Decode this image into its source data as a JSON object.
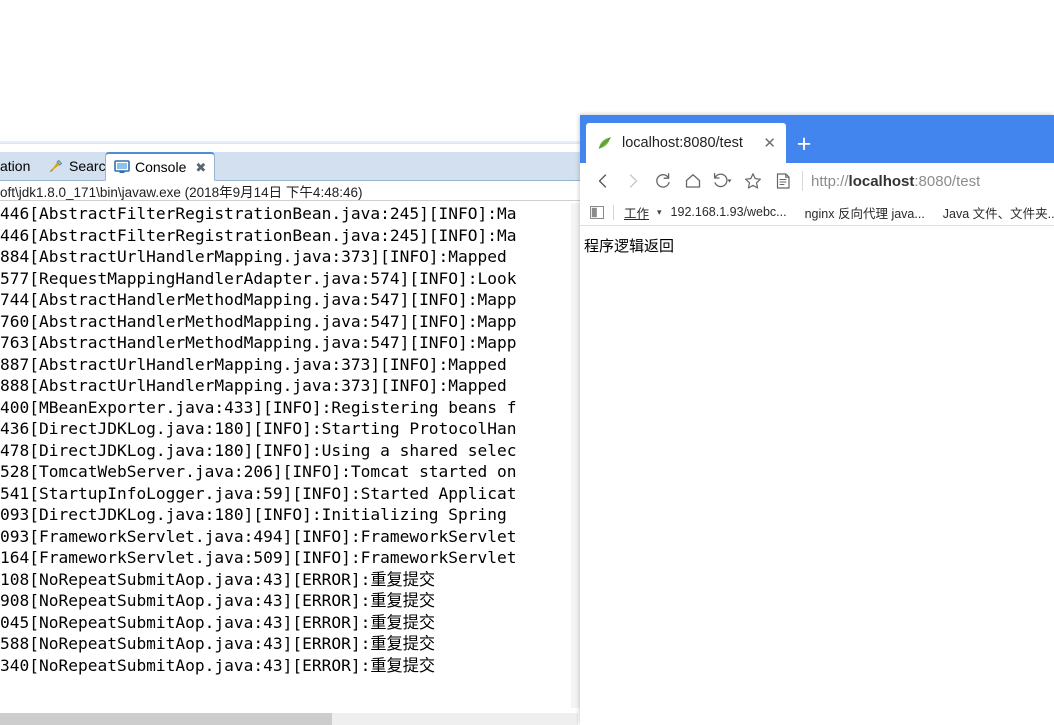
{
  "eclipse": {
    "tabs": [
      {
        "label": "ation",
        "icon": "",
        "active": false,
        "closable": false
      },
      {
        "label": "Search",
        "icon": "search-icon",
        "active": false,
        "closable": false
      },
      {
        "label": "Console",
        "icon": "console-icon",
        "active": true,
        "closable": true,
        "close_glyph": "✖"
      }
    ],
    "console_header": "oft\\jdk1.8.0_171\\bin\\javaw.exe (2018年9月14日 下午4:48:46)",
    "log_lines": [
      "446[AbstractFilterRegistrationBean.java:245][INFO]:Ma",
      "446[AbstractFilterRegistrationBean.java:245][INFO]:Ma",
      "884[AbstractUrlHandlerMapping.java:373][INFO]:Mapped",
      "577[RequestMappingHandlerAdapter.java:574][INFO]:Look",
      "744[AbstractHandlerMethodMapping.java:547][INFO]:Mapp",
      "760[AbstractHandlerMethodMapping.java:547][INFO]:Mapp",
      "763[AbstractHandlerMethodMapping.java:547][INFO]:Mapp",
      "887[AbstractUrlHandlerMapping.java:373][INFO]:Mapped",
      "888[AbstractUrlHandlerMapping.java:373][INFO]:Mapped",
      "400[MBeanExporter.java:433][INFO]:Registering beans f",
      "436[DirectJDKLog.java:180][INFO]:Starting ProtocolHan",
      "478[DirectJDKLog.java:180][INFO]:Using a shared selec",
      "528[TomcatWebServer.java:206][INFO]:Tomcat started on",
      "541[StartupInfoLogger.java:59][INFO]:Started Applicat",
      "093[DirectJDKLog.java:180][INFO]:Initializing Spring",
      "093[FrameworkServlet.java:494][INFO]:FrameworkServlet",
      "164[FrameworkServlet.java:509][INFO]:FrameworkServlet",
      "108[NoRepeatSubmitAop.java:43][ERROR]:重复提交",
      "908[NoRepeatSubmitAop.java:43][ERROR]:重复提交",
      "045[NoRepeatSubmitAop.java:43][ERROR]:重复提交",
      "588[NoRepeatSubmitAop.java:43][ERROR]:重复提交",
      "340[NoRepeatSubmitAop.java:43][ERROR]:重复提交"
    ]
  },
  "browser": {
    "tab": {
      "title": "localhost:8080/test",
      "close_glyph": "✕",
      "favicon": "spring-leaf-icon"
    },
    "new_tab_glyph": "+",
    "nav": {
      "back": "back-icon",
      "forward": "forward-icon",
      "refresh": "refresh-icon",
      "home": "home-icon",
      "history": "history-icon",
      "favorite": "star-icon",
      "reading_list": "reading-list-icon"
    },
    "url": {
      "scheme": "http://",
      "host": "localhost",
      "rest": ":8080/test",
      "full": "http://localhost:8080/test"
    },
    "bookmarks": {
      "apps_icon": "apps-icon",
      "items": [
        {
          "label": "工作",
          "caret": "▾"
        },
        {
          "label": "192.168.1.93/webc..."
        },
        {
          "label": "nginx 反向代理 java..."
        },
        {
          "label": "Java 文件、文件夹..."
        }
      ]
    },
    "page": {
      "text": "程序逻辑返回"
    }
  },
  "colors": {
    "browser_accent": "#4285ee",
    "eclipse_tabbar": "#d3e0ef",
    "eclipse_tab_active_top": "#4a90d9",
    "scrollbar_thumb": "#cdcdcd"
  }
}
